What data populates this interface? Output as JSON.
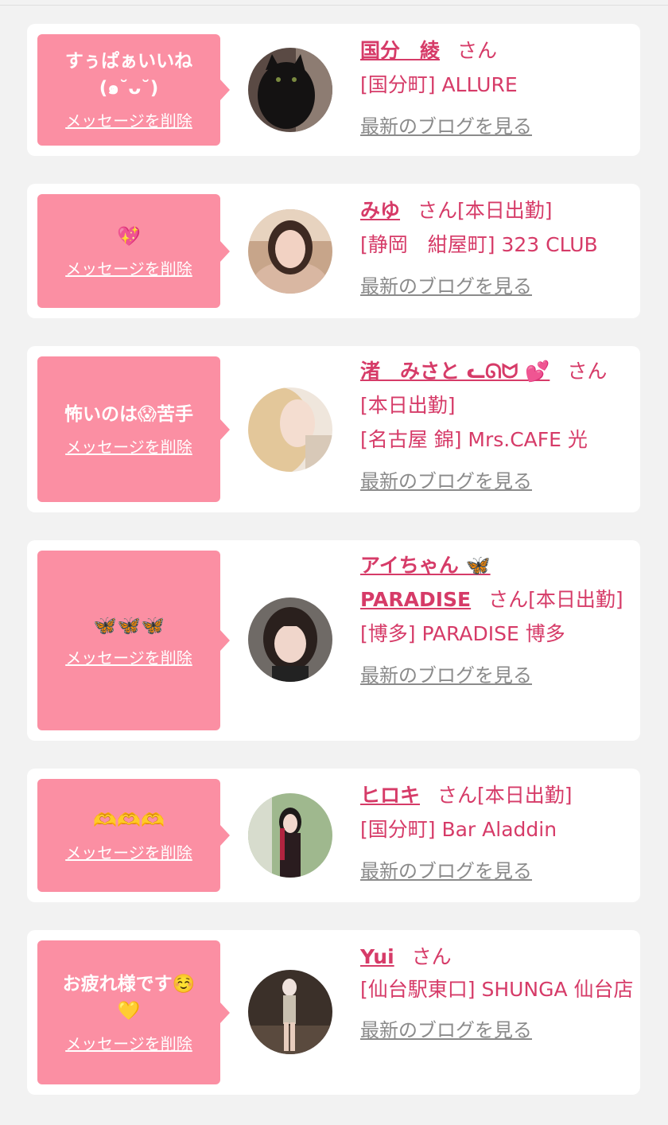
{
  "labels": {
    "delete_message": "メッセージを削除",
    "latest_blog": "最新のブログを見る",
    "honorific": "さん"
  },
  "cards": [
    {
      "message_line1": "すぅぱぁいいね",
      "message_line2": "(๑˘ᴗ˘)",
      "name": "国分　綾",
      "status": "",
      "shop": "[国分町] ALLURE"
    },
    {
      "message_line1": "💖",
      "name": "みゆ",
      "status": "[本日出勤]",
      "shop": "[静岡　紺屋町] 323 CLUB"
    },
    {
      "message_line1": "怖いのは😱苦手",
      "name": "渚　みさと ᓚᘏᗢ 💕",
      "status": "[本日出勤]",
      "shop": "[名古屋 錦] Mrs.CAFE 光"
    },
    {
      "message_line1": "🦋🦋🦋",
      "name_line1": "アイちゃん 🦋",
      "name_line2": "PARADISE",
      "status": "[本日出勤]",
      "shop": "[博多] PARADISE 博多"
    },
    {
      "message_line1": "🫶🫶🫶",
      "name": "ヒロキ",
      "status": "[本日出勤]",
      "shop": "[国分町] Bar Aladdin"
    },
    {
      "message_line1": "お疲れ様です☺️",
      "message_line2": "💛",
      "name": "Yui",
      "status": "",
      "shop": "[仙台駅東口] SHUNGA 仙台店"
    }
  ]
}
